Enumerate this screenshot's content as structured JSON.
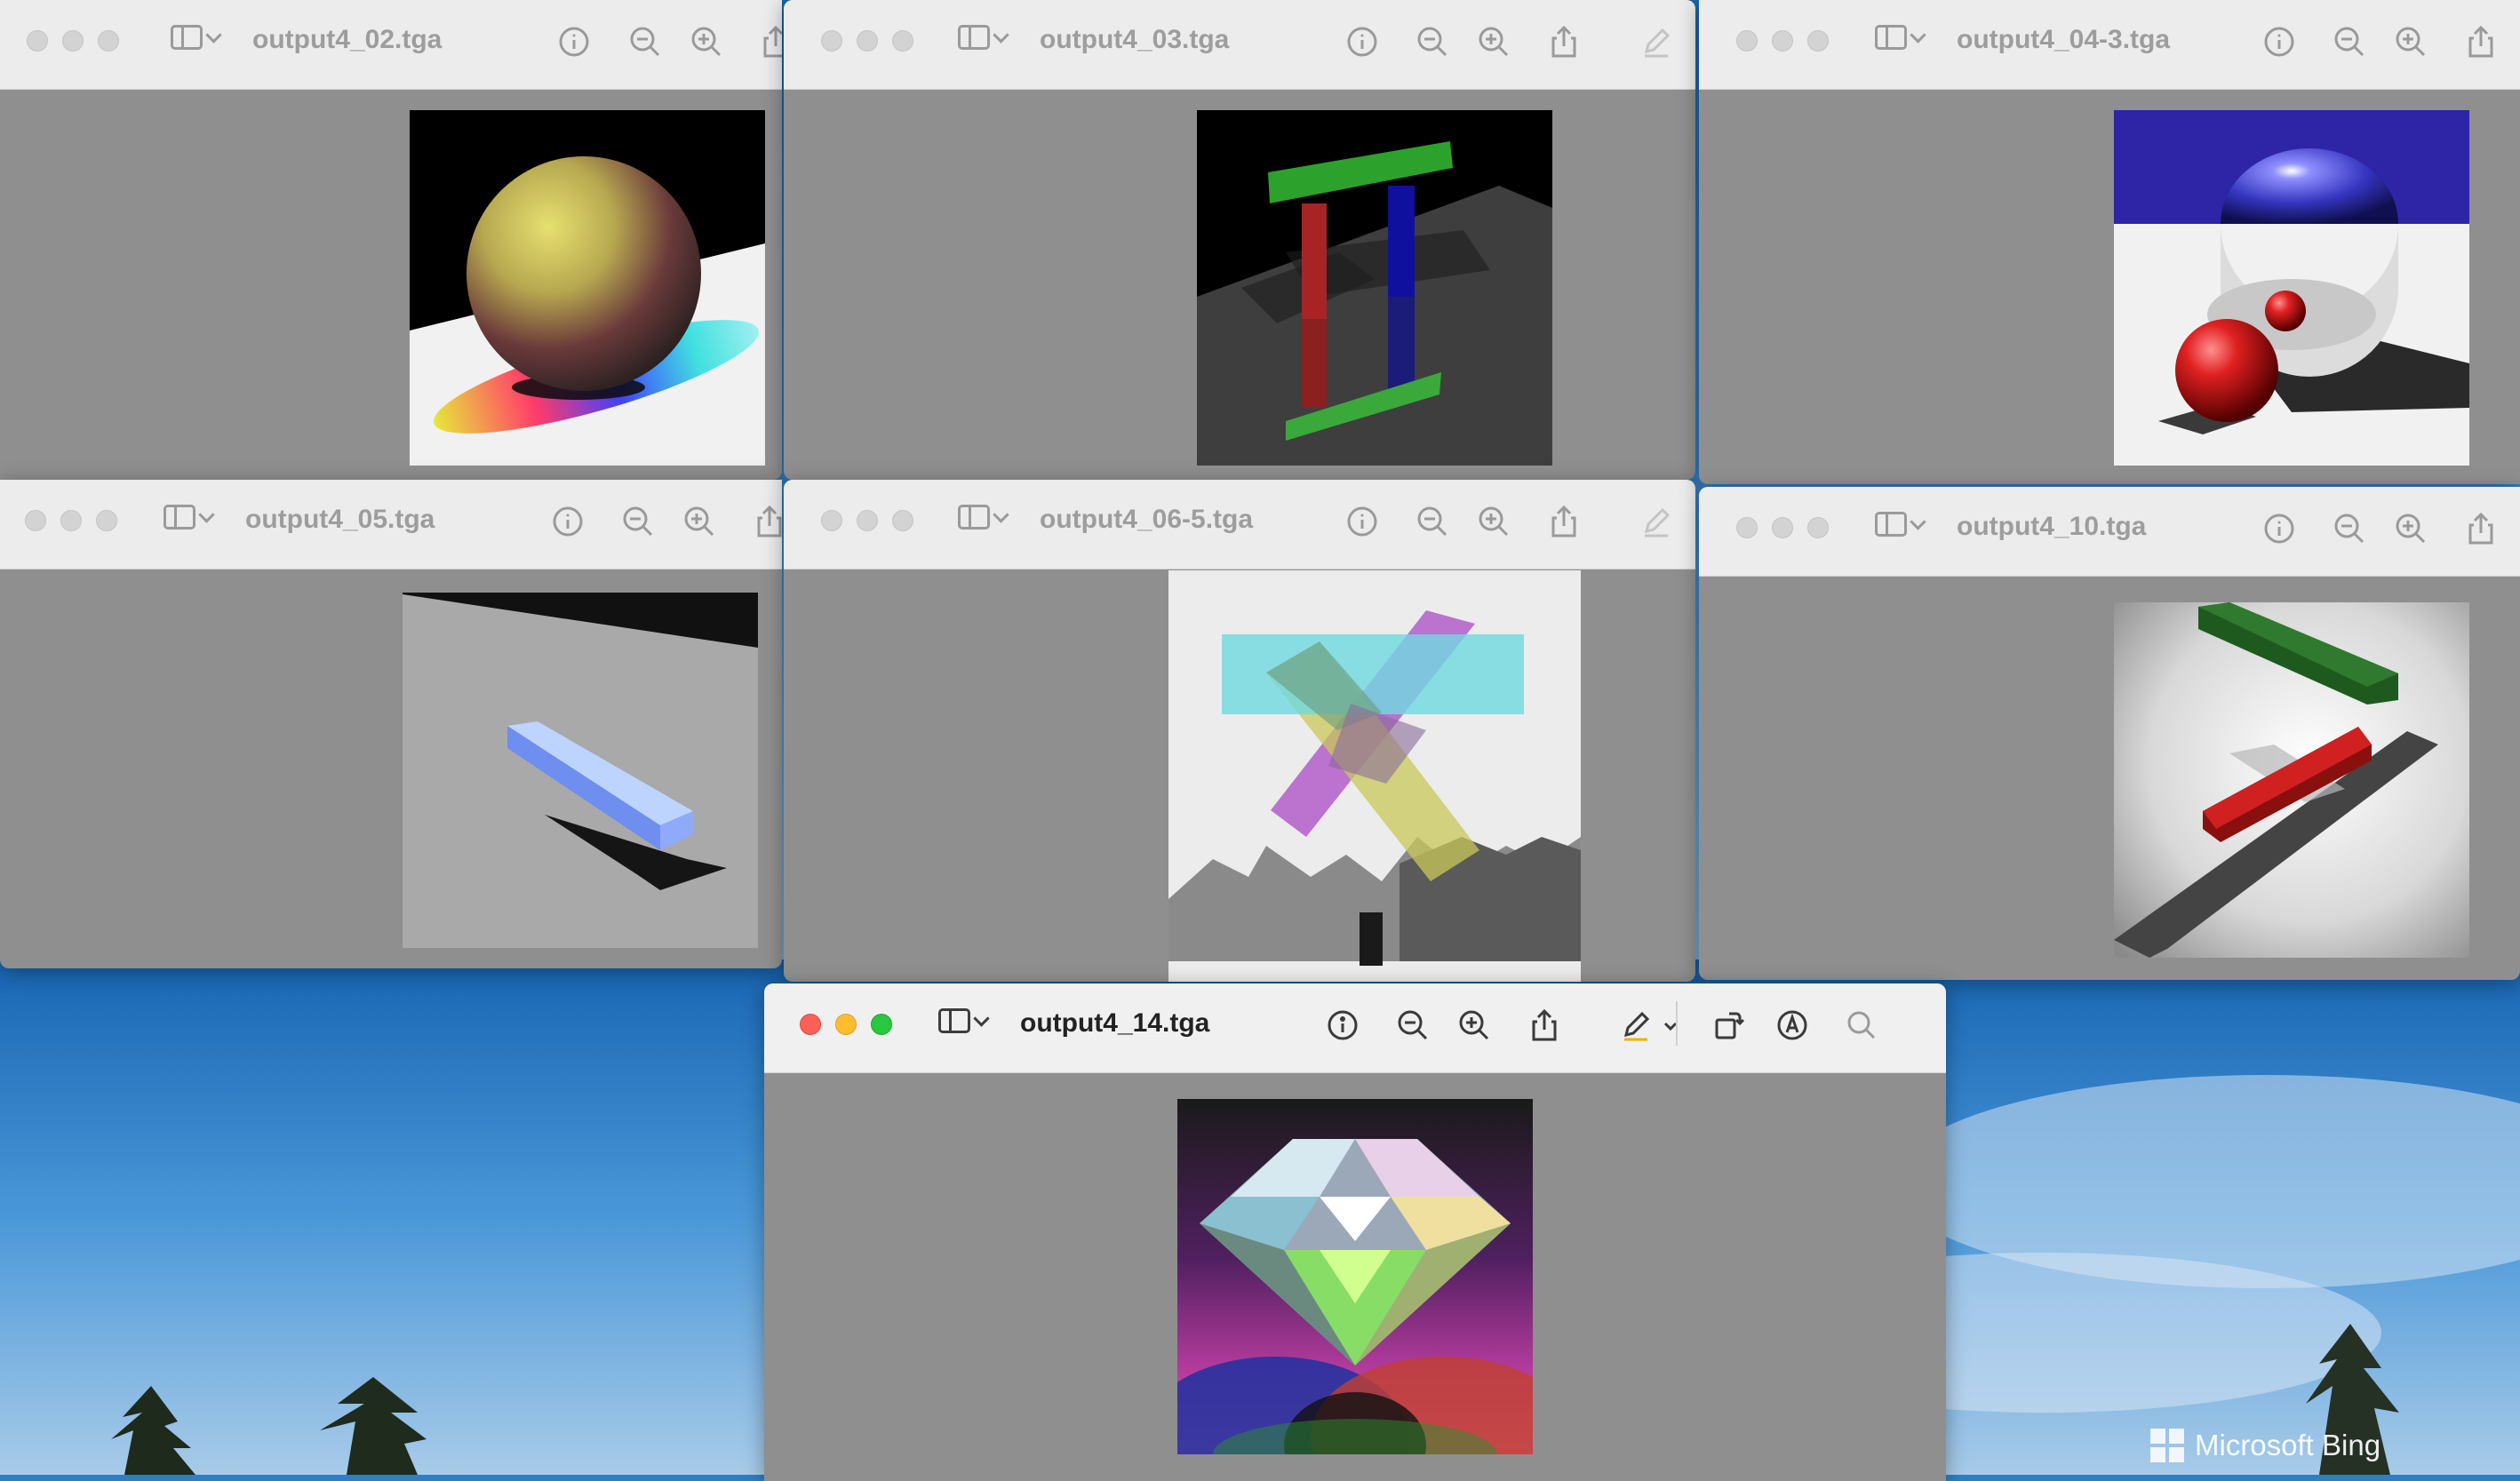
{
  "windows": [
    {
      "id": "w02",
      "title": "output4_02.tga"
    },
    {
      "id": "w03",
      "title": "output4_03.tga"
    },
    {
      "id": "w04",
      "title": "output4_04-3.tga"
    },
    {
      "id": "w05",
      "title": "output4_05.tga"
    },
    {
      "id": "w06",
      "title": "output4_06-5.tga"
    },
    {
      "id": "w10",
      "title": "output4_10.tga"
    },
    {
      "id": "w14",
      "title": "output4_14.tga"
    }
  ],
  "wallpaper": {
    "brand": "Microsoft Bing"
  },
  "colors": {
    "titlebar": "#ececec",
    "viewer_bg": "#8f8f8f",
    "close": "#fe5f57",
    "minimize": "#febc2e",
    "zoom": "#28c840"
  }
}
